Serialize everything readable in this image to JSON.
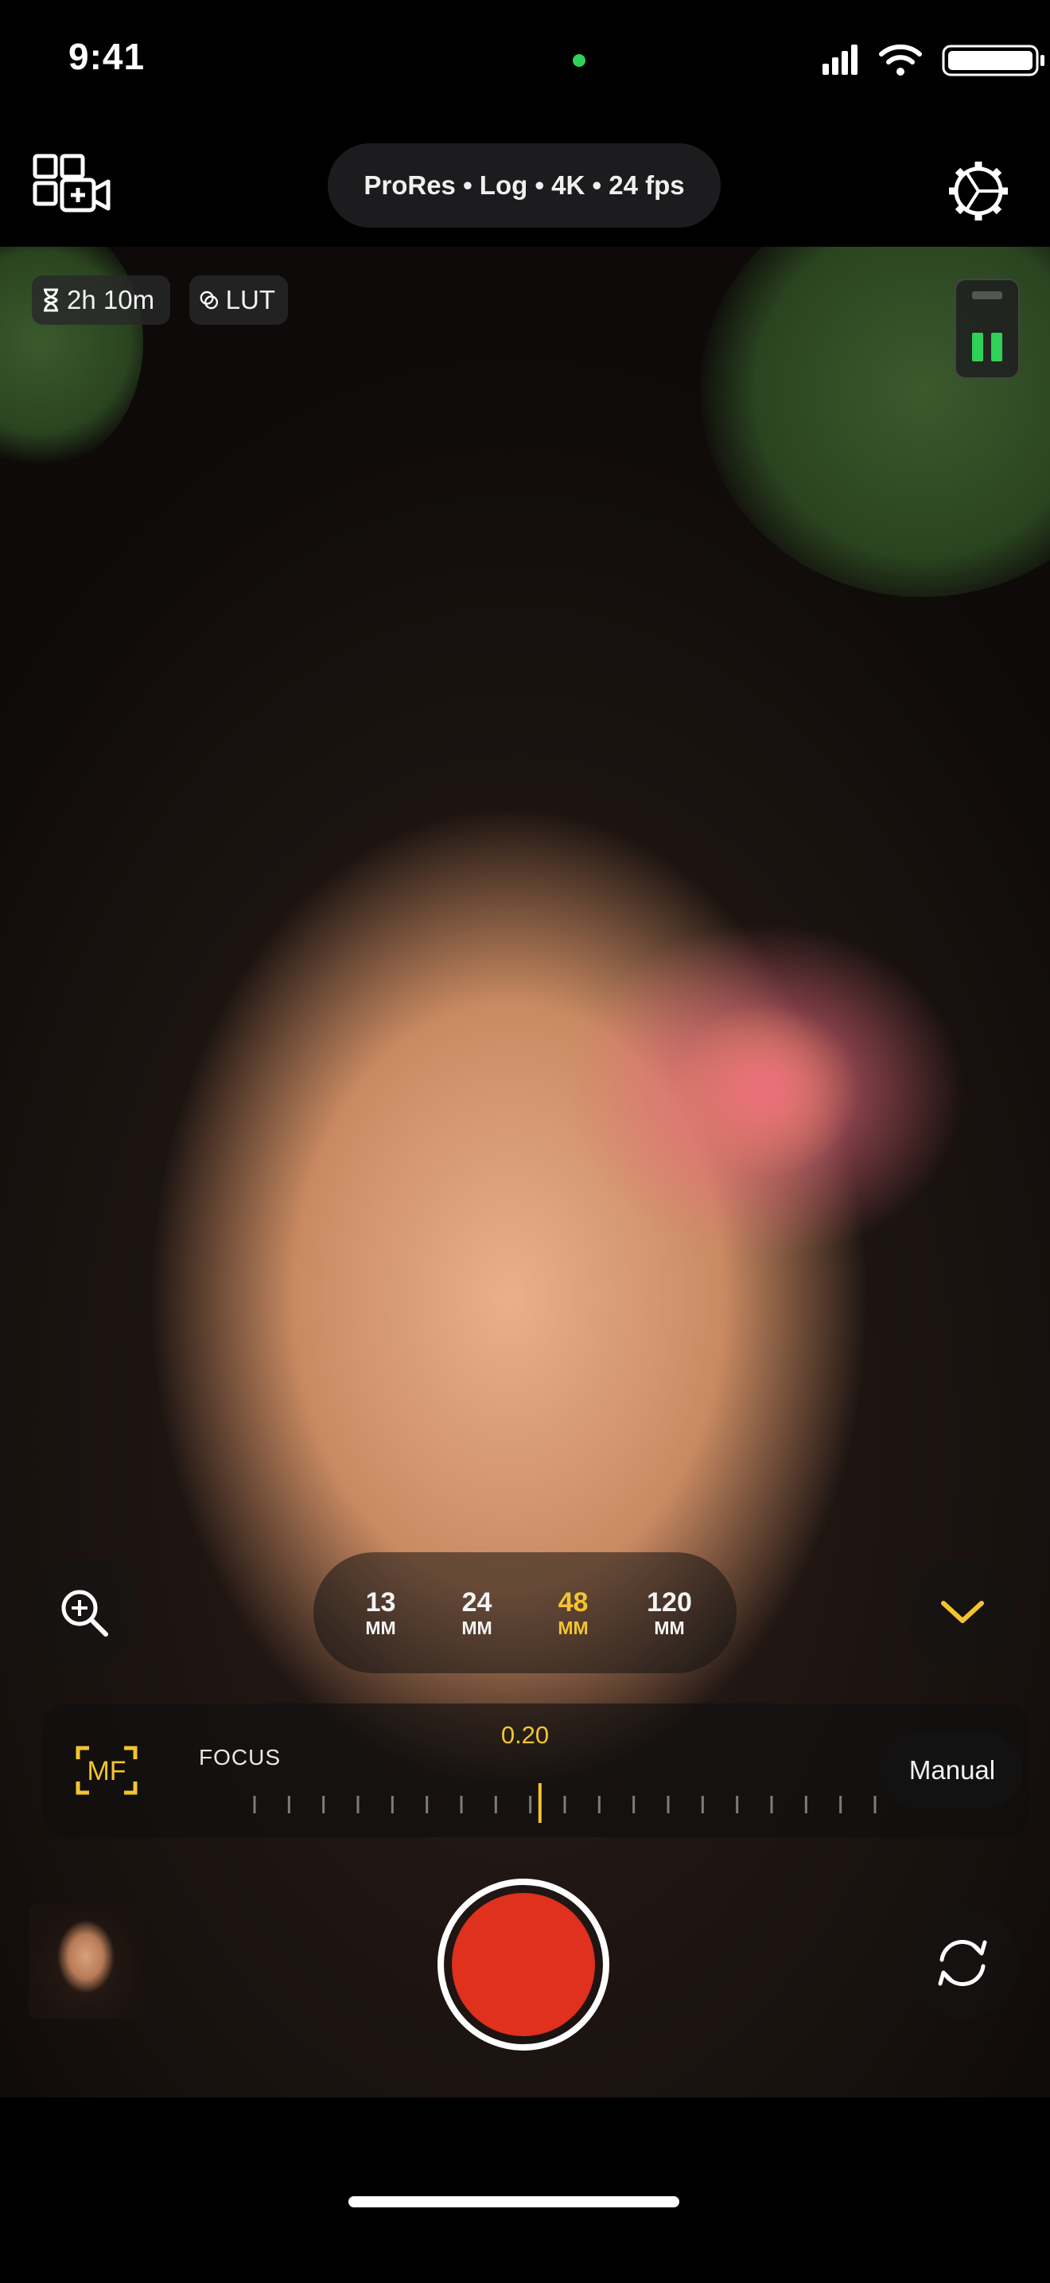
{
  "status_bar": {
    "time": "9:41",
    "privacy_indicator_color": "#30d158"
  },
  "top_bar": {
    "format_summary": "ProRes • Log • 4K • 24 fps",
    "multicam_icon": "multicam-add-icon",
    "settings_icon": "gear-icon"
  },
  "badges": {
    "record_time": "2h 10m",
    "lut": "LUT"
  },
  "audio_meter": {
    "color": "#30d158"
  },
  "lenses": [
    {
      "value": "13",
      "unit": "MM",
      "active": false
    },
    {
      "value": "24",
      "unit": "MM",
      "active": false
    },
    {
      "value": "48",
      "unit": "MM",
      "active": true
    },
    {
      "value": "120",
      "unit": "MM",
      "active": false
    }
  ],
  "focus": {
    "mf_label": "MF",
    "label": "FOCUS",
    "value": "0.20",
    "value_fraction": 0.46,
    "mode": "Manual"
  },
  "colors": {
    "accent": "#f4c430",
    "record": "#e0301e"
  }
}
